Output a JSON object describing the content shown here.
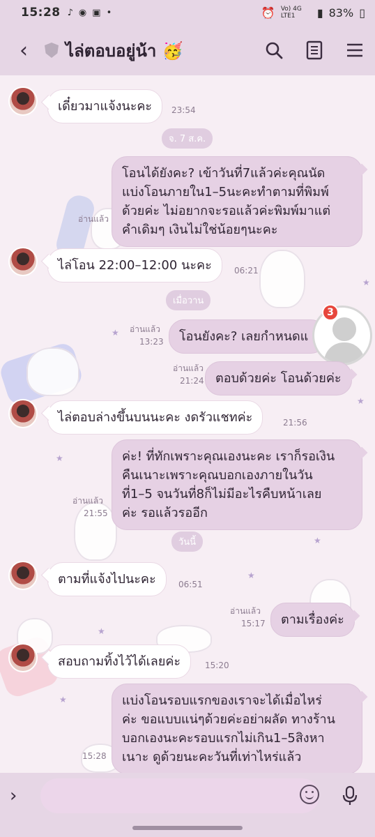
{
  "status_bar": {
    "time": "15:28",
    "icons": [
      "tiktok-icon",
      "messenger-icon",
      "shopping-icon",
      "dot-icon"
    ],
    "network": "Vo) 4G LTE1",
    "battery": "83%"
  },
  "header": {
    "title": "ไล่ตอบอยู่น้า 🥳"
  },
  "chat": {
    "date_chips": [
      "จ. 7 ส.ค.",
      "เมื่อวาน",
      "วันนี้"
    ],
    "messages": [
      {
        "from": "them",
        "text": "เดี๋ยวมาแจ้งนะคะ",
        "time": "23:54"
      },
      {
        "from": "me",
        "text": "โอนได้ยังคะ? เข้าวันที่7แล้วค่ะคุณนัดแบ่งโอนภายใน1–5นะคะทำตามที่พิมพ์ด้วยค่ะ ไม่อยากจะรอแล้วค่ะพิมพ์มาแต่คำเดิมๆ เงินไม่ใช่น้อยๆนะคะ",
        "read": "อ่านแล้ว"
      },
      {
        "from": "them",
        "text": "ไล่โอน 22:00–12:00 นะคะ",
        "time": "06:21"
      },
      {
        "from": "me",
        "text": "โอนยังคะ? เลยกำหนดแล้วค่ะ",
        "read": "อ่านแล้ว",
        "time": "13:23"
      },
      {
        "from": "me",
        "text": "ตอบด้วยค่ะ โอนด้วยค่ะ",
        "read": "อ่านแล้ว",
        "time": "21:24"
      },
      {
        "from": "them",
        "text": "ไล่ตอบล่างขึ้นบนนะคะ งดรัวแชทค่ะ",
        "time": "21:56"
      },
      {
        "from": "me",
        "text": "ค่ะ! ที่ทักเพราะคุณเองนะคะ เราก็รอเงินคืนเนาะเพราะคุณบอกเองภายในวันที่1–5 จนวันที่8ก็ไม่มีอะไรคืบหน้าเลยค่ะ รอแล้วรออีก",
        "read": "อ่านแล้ว",
        "time": "21:55"
      },
      {
        "from": "them",
        "text": "ตามที่แจ้งไปนะคะ",
        "time": "06:51"
      },
      {
        "from": "me",
        "text": "ตามเรื่องค่ะ",
        "read": "อ่านแล้ว",
        "time": "15:17"
      },
      {
        "from": "them",
        "text": "สอบถามทิ้งไว้ได้เลยค่ะ",
        "time": "15:20"
      },
      {
        "from": "me",
        "text": "แบ่งโอนรอบแรกของเราจะได้เมื่อไหร่ค่ะ ขอแบบแน่ๆด้วยค่ะอย่าผลัด ทางร้านบอกเองนะคะรอบแรกไม่เกิน1–5สิงหาเนาะ ดูด้วยนะคะวันที่เท่าไหร่แล้ว",
        "time": "15:28"
      }
    ],
    "line_lines": {
      "m1": [
        "โอนได้ยังคะ? เข้าวันที่7แล้วค่ะคุณนัด",
        "แบ่งโอนภายใน1–5นะคะทำตามที่พิมพ์",
        "ด้วยค่ะ ไม่อยากจะรอแล้วค่ะพิมพ์มาแต่",
        "คำเดิมๆ เงินไม่ใช่น้อยๆนะคะ"
      ],
      "m6": [
        "ค่ะ! ที่ทักเพราะคุณเองนะคะ เราก็รอเงิน",
        "คืนเนาะเพราะคุณบอกเองภายในวัน",
        "ที่1–5 จนวันที่8ก็ไม่มีอะไรคืบหน้าเลย",
        "ค่ะ รอแล้วรออีก"
      ],
      "m10": [
        "แบ่งโอนรอบแรกของเราจะได้เมื่อไหร่",
        "ค่ะ ขอแบบแน่ๆด้วยค่ะอย่าผลัด ทางร้าน",
        "บอกเองนะคะรอบแรกไม่เกิน1–5สิงหา",
        "เนาะ ดูด้วยนะคะวันที่เท่าไหร่แล้ว"
      ]
    },
    "notification_badge": "3",
    "partial_bubble_text": "โอนยังคะ? เลยกำหนดแ"
  },
  "input": {
    "placeholder": ""
  },
  "colors": {
    "header_bg": "#e6d6e5",
    "my_bubble": "#e6d1e4",
    "their_bubble": "#ffffff",
    "badge": "#e7463c"
  }
}
